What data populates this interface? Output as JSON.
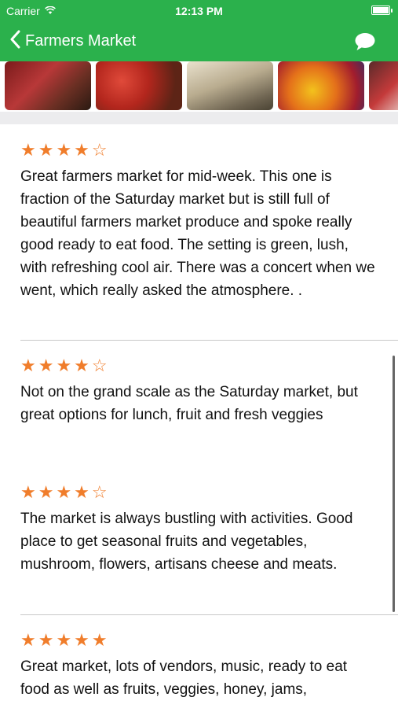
{
  "status_bar": {
    "carrier": "Carrier",
    "time": "12:13 PM",
    "battery_level": 1.0
  },
  "nav": {
    "title": "Farmers Market",
    "back_icon": "chevron-left-icon",
    "chat_icon": "chat-bubble-icon"
  },
  "photos": [
    {
      "name": "strawberries-photo"
    },
    {
      "name": "tomatoes-photo"
    },
    {
      "name": "root-vegetables-photo"
    },
    {
      "name": "peppers-photo"
    },
    {
      "name": "berries-photo"
    }
  ],
  "reviews": [
    {
      "stars": "★★★★☆",
      "rating": 4,
      "text": "Great farmers market for mid-week. This one is fraction of the Saturday market but is still full of beautiful farmers market produce and spoke really good ready to eat food. The setting is green, lush, with refreshing cool air. There was a concert when we went, which really asked the atmosphere. ."
    },
    {
      "stars": "★★★★☆",
      "rating": 4,
      "text": "Not on the grand scale as the Saturday market, but great options for lunch, fruit and fresh veggies"
    },
    {
      "stars": "★★★★☆",
      "rating": 4,
      "text": "The market is always bustling with activities. Good place to get seasonal fruits and vegetables, mushroom, flowers, artisans cheese and meats."
    },
    {
      "stars": "★★★★★",
      "rating": 5,
      "text": "Great market, lots of vendors, music, ready to eat food as well as fruits, veggies, honey, jams,"
    }
  ],
  "colors": {
    "nav_green": "#2bb14c",
    "star_orange": "#f07d2b"
  }
}
